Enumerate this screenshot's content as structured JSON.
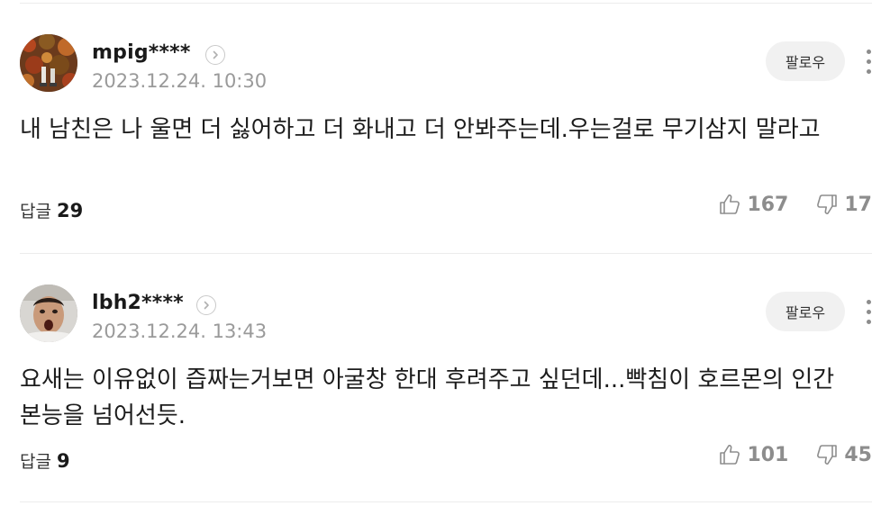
{
  "comments": [
    {
      "username": "mpig****",
      "date": "2023.12.24. 10:30",
      "follow_label": "팔로우",
      "text": "내 남친은 나 울면 더 싫어하고 더 화내고 더 안봐주는데.우는걸로 무기삼지 말라고",
      "reply_label": "답글",
      "reply_count": "29",
      "likes": "167",
      "dislikes": "17",
      "avatar_icon": "autumn-leaves-photo-icon"
    },
    {
      "username": "lbh2****",
      "date": "2023.12.24. 13:43",
      "follow_label": "팔로우",
      "text": "요새는 이유없이 즙짜는거보면 아굴창 한대 후려주고 싶던데...빡침이 호르몬의 인간 본능을 넘어선듯.",
      "reply_label": "답글",
      "reply_count": "9",
      "likes": "101",
      "dislikes": "45",
      "avatar_icon": "shocked-face-photo-icon"
    }
  ],
  "colors": {
    "text": "#1c1c1c",
    "muted": "#9a9a9a",
    "button_bg": "#f1f1f1",
    "divider": "#ececec"
  }
}
